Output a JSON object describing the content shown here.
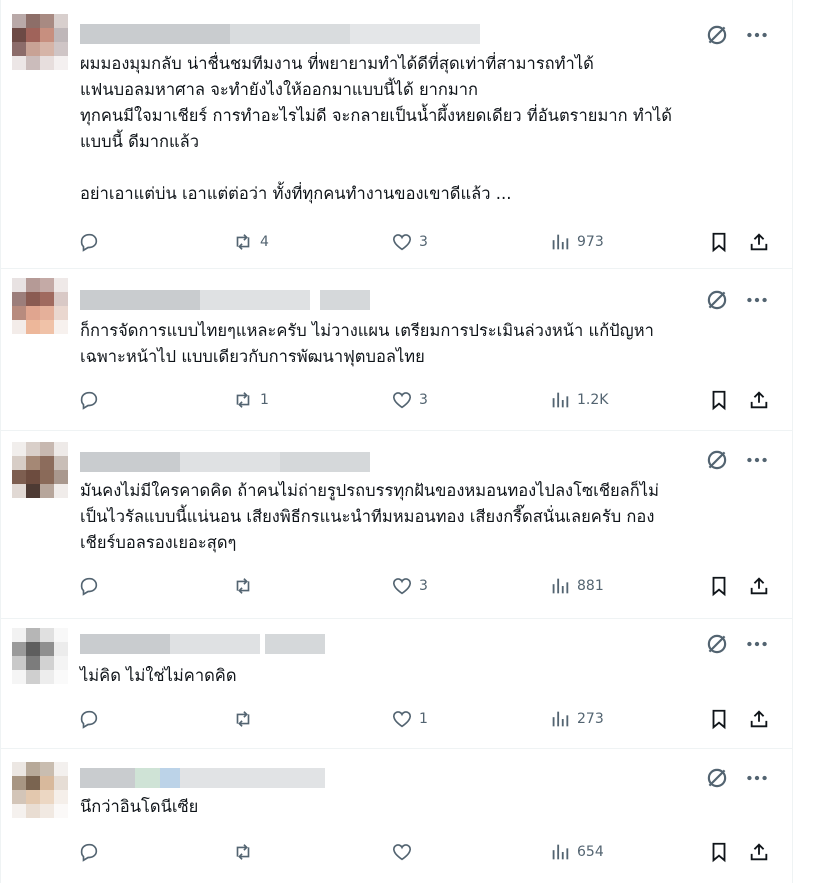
{
  "colors": {
    "text": "#0f1419",
    "muted": "#536471",
    "divider": "#eff3f4"
  },
  "icons": {
    "grok": "grok-slash-circle-icon",
    "more": "more-dots-icon",
    "reply": "reply-bubble-icon",
    "repost": "repost-arrows-icon",
    "like": "heart-icon",
    "views": "views-bar-chart-icon",
    "bookmark": "bookmark-icon",
    "share": "share-upload-icon"
  },
  "posts": [
    {
      "text": "ผมมองมุมกลับ น่าชื่นชมทีมงาน ที่พยายามทำได้ดีที่สุดเท่าที่สามารถทำได้\nแฟนบอลมหาศาล จะทำยังไงให้ออกมาแบบนี้ได้ ยากมาก\nทุกคนมีใจมาเชียร์ การทำอะไรไม่ดี จะกลายเป็นน้ำผึ้งหยดเดียว ที่อันตรายมาก ทำได้\nแบบนี้ ดีมากแล้ว\n\nอย่าเอาแต่บ่น เอาแต่ต่อว่า ทั้งที่ทุกคนทำงานของเขาดีแล้ว ...",
      "replies": "",
      "reposts": "4",
      "likes": "3",
      "views": "973"
    },
    {
      "text": "ก็การจัดการแบบไทยๆแหละครับ ไม่วางแผน เตรียมการประเมินล่วงหน้า แก้ปัญหา\nเฉพาะหน้าไป แบบเดียวกับการพัฒนาฟุตบอลไทย",
      "replies": "",
      "reposts": "1",
      "likes": "3",
      "views": "1.2K"
    },
    {
      "text": "มันคงไม่มีใครคาดคิด ถ้าคนไม่ถ่ายรูปรถบรรทุกฝันของหมอนทองไปลงโซเชียลก็ไม่\nเป็นไวรัลแบบนี้แน่นอน เสียงพิธีกรแนะนำทีมหมอนทอง เสียงกรี๊ดสนั่นเลยครับ กอง\nเชียร์บอลรองเยอะสุดๆ",
      "replies": "",
      "reposts": "",
      "likes": "3",
      "views": "881"
    },
    {
      "text": "ไม่คิด ไม่ใช่ไม่คาดคิด",
      "replies": "",
      "reposts": "",
      "likes": "1",
      "views": "273"
    },
    {
      "text": "นึกว่าอินโดนีเซีย",
      "replies": "",
      "reposts": "",
      "likes": "",
      "views": "654"
    }
  ]
}
